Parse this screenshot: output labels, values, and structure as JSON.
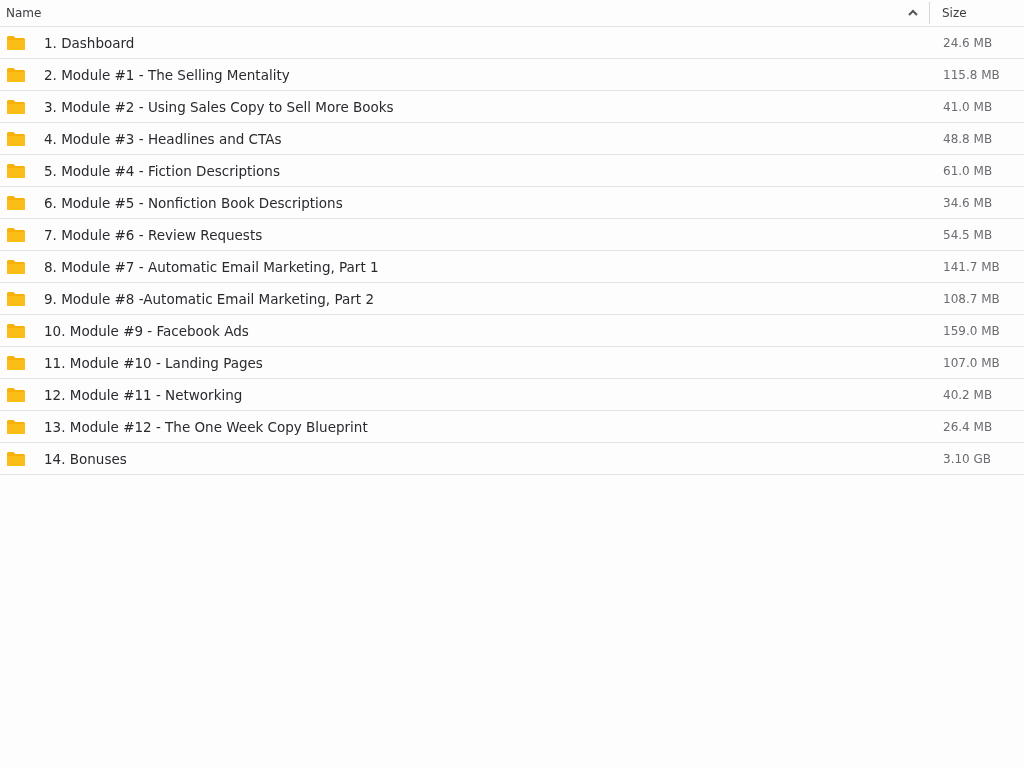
{
  "table": {
    "columns": [
      {
        "label": "Name",
        "sorted": true
      },
      {
        "label": "Size",
        "sorted": false
      }
    ],
    "rows": [
      {
        "name": "1. Dashboard",
        "size": "24.6 MB"
      },
      {
        "name": "2. Module #1 - The Selling Mentality",
        "size": "115.8 MB"
      },
      {
        "name": "3. Module #2 - Using Sales Copy to Sell More Books",
        "size": "41.0 MB"
      },
      {
        "name": "4. Module #3 - Headlines and CTAs",
        "size": "48.8 MB"
      },
      {
        "name": "5. Module #4 - Fiction Descriptions",
        "size": "61.0 MB"
      },
      {
        "name": "6. Module #5 - Nonfiction Book Descriptions",
        "size": "34.6 MB"
      },
      {
        "name": "7. Module #6 - Review Requests",
        "size": "54.5 MB"
      },
      {
        "name": "8. Module #7 - Automatic Email Marketing, Part 1",
        "size": "141.7 MB"
      },
      {
        "name": "9. Module #8 -Automatic Email Marketing, Part 2",
        "size": "108.7 MB"
      },
      {
        "name": "10. Module #9 - Facebook Ads",
        "size": "159.0 MB"
      },
      {
        "name": "11. Module #10 - Landing Pages",
        "size": "107.0 MB"
      },
      {
        "name": "12. Module #11 - Networking",
        "size": "40.2 MB"
      },
      {
        "name": "13. Module #12 - The One Week Copy Blueprint",
        "size": "26.4 MB"
      },
      {
        "name": "14. Bonuses",
        "size": "3.10 GB"
      }
    ]
  }
}
